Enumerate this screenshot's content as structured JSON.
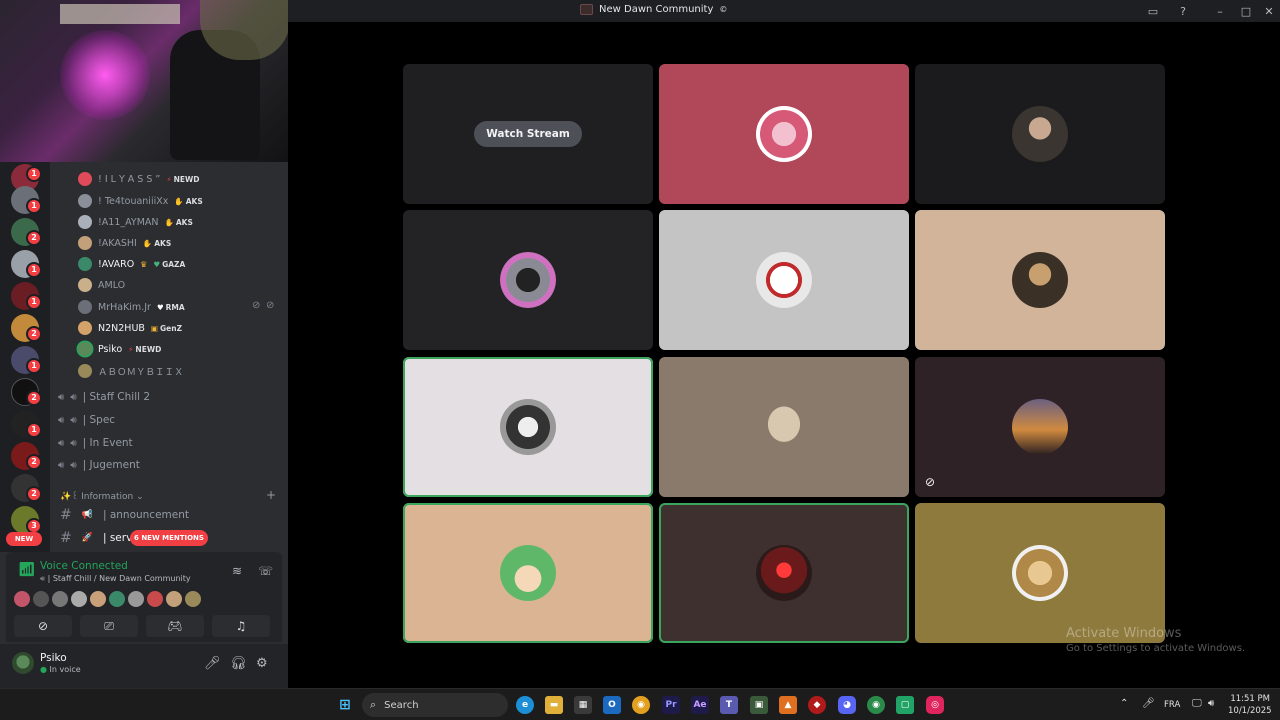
{
  "window": {
    "title": "New Dawn Community",
    "controls": [
      "inbox-icon",
      "help-icon",
      "minimize-icon",
      "maximize-icon",
      "close-icon"
    ]
  },
  "servers": {
    "badges": [
      "1",
      "1",
      "2",
      "1",
      "1",
      "2",
      "1",
      "2",
      "1",
      "2",
      "2",
      "3"
    ],
    "new_label": "NEW"
  },
  "members": [
    {
      "name": "! I L Y A S S ”",
      "tag": "NEWD",
      "tag_icon": "⚡",
      "color": "#e04b5a"
    },
    {
      "name": "! Te4touaniiiXx",
      "tag": "AKS",
      "tag_icon": "✋",
      "color": "#8a8f99"
    },
    {
      "name": "!A11_AYMAN",
      "tag": "AKS",
      "tag_icon": "✋",
      "color": "#aab0ba"
    },
    {
      "name": "!AKASHI",
      "tag": "AKS",
      "tag_icon": "✋",
      "color": "#c2a07a"
    },
    {
      "name": "!AVARO",
      "tag": "GAZA",
      "tag_icon": "♥",
      "color": "#3a8a6a",
      "bold": true
    },
    {
      "name": "AMLO",
      "tag": "",
      "tag_icon": "",
      "color": "#c9b08a"
    },
    {
      "name": "MrHaKim.Jr",
      "tag": "RMA",
      "tag_icon": "♥",
      "color": "#6b6f78"
    },
    {
      "name": "N2N2HUB",
      "tag": "GenZ",
      "tag_icon": "▣",
      "color": "#d4a36a",
      "bold": true
    },
    {
      "name": "Psiko",
      "tag": "NEWD",
      "tag_icon": "⚡",
      "color": "#5a8a5a",
      "bold": true
    },
    {
      "name": "ＡＢＯＭＹＢＩＩＸ",
      "tag": "",
      "tag_icon": "",
      "color": "#9a8a5a"
    }
  ],
  "voice_channels": [
    "| Staff Chill 2",
    "| Spec",
    "| In Event",
    "| Jugement"
  ],
  "category": {
    "name": "✨꒰ Information",
    "add": "+"
  },
  "text_channels": [
    {
      "emoji": "📢",
      "name": "| announcement"
    },
    {
      "emoji": "🚀",
      "name": "| server"
    }
  ],
  "mentions_label": "6 NEW MENTIONS",
  "voice": {
    "title": "Voice Connected",
    "subtitle": "| Staff Chill / New Dawn Community",
    "participant_colors": [
      "#c2556a",
      "#555",
      "#777",
      "#aaa",
      "#c9a07a",
      "#3a8a6a",
      "#999",
      "#c94a4a",
      "#c2a07a",
      "#9a8a5a"
    ],
    "buttons": [
      "camera-off-icon",
      "screen-share-icon",
      "activity-icon",
      "soundboard-icon"
    ]
  },
  "user": {
    "name": "Psiko",
    "status": "In voice"
  },
  "stream": {
    "watch_label": "Watch Stream",
    "tiles": [
      {
        "bg": "#1f1f21",
        "avatar": "",
        "speaking": false,
        "watch": true
      },
      {
        "bg": "#b1485a",
        "avatar": "#e8a0b4",
        "speaking": false
      },
      {
        "bg": "#1b1b1d",
        "avatar": "#3a3530",
        "speaking": false
      },
      {
        "bg": "#232325",
        "avatar": "#7a7a85",
        "speaking": false
      },
      {
        "bg": "#c4c4c4",
        "avatar": "#d8d8d8",
        "speaking": false
      },
      {
        "bg": "#d1b49a",
        "avatar": "#5a4a3a",
        "speaking": false
      },
      {
        "bg": "#e3dfe2",
        "avatar": "#444",
        "speaking": true
      },
      {
        "bg": "#8a7a6c",
        "avatar": "#b8a890",
        "speaking": false
      },
      {
        "bg": "#2f2226",
        "avatar": "#6a5040",
        "speaking": false,
        "muted": true
      },
      {
        "bg": "#dbb494",
        "avatar": "#5fb86a",
        "speaking": true
      },
      {
        "bg": "#3f3030",
        "avatar": "#8a2a2a",
        "speaking": true
      },
      {
        "bg": "#8e7a3d",
        "avatar": "#c8a860",
        "speaking": false
      }
    ]
  },
  "activation": {
    "line1": "Activate Windows",
    "line2": "Go to Settings to activate Windows."
  },
  "taskbar": {
    "search": "Search",
    "language": "FRA",
    "time": "11:51 PM",
    "date": "10/1/2025"
  }
}
